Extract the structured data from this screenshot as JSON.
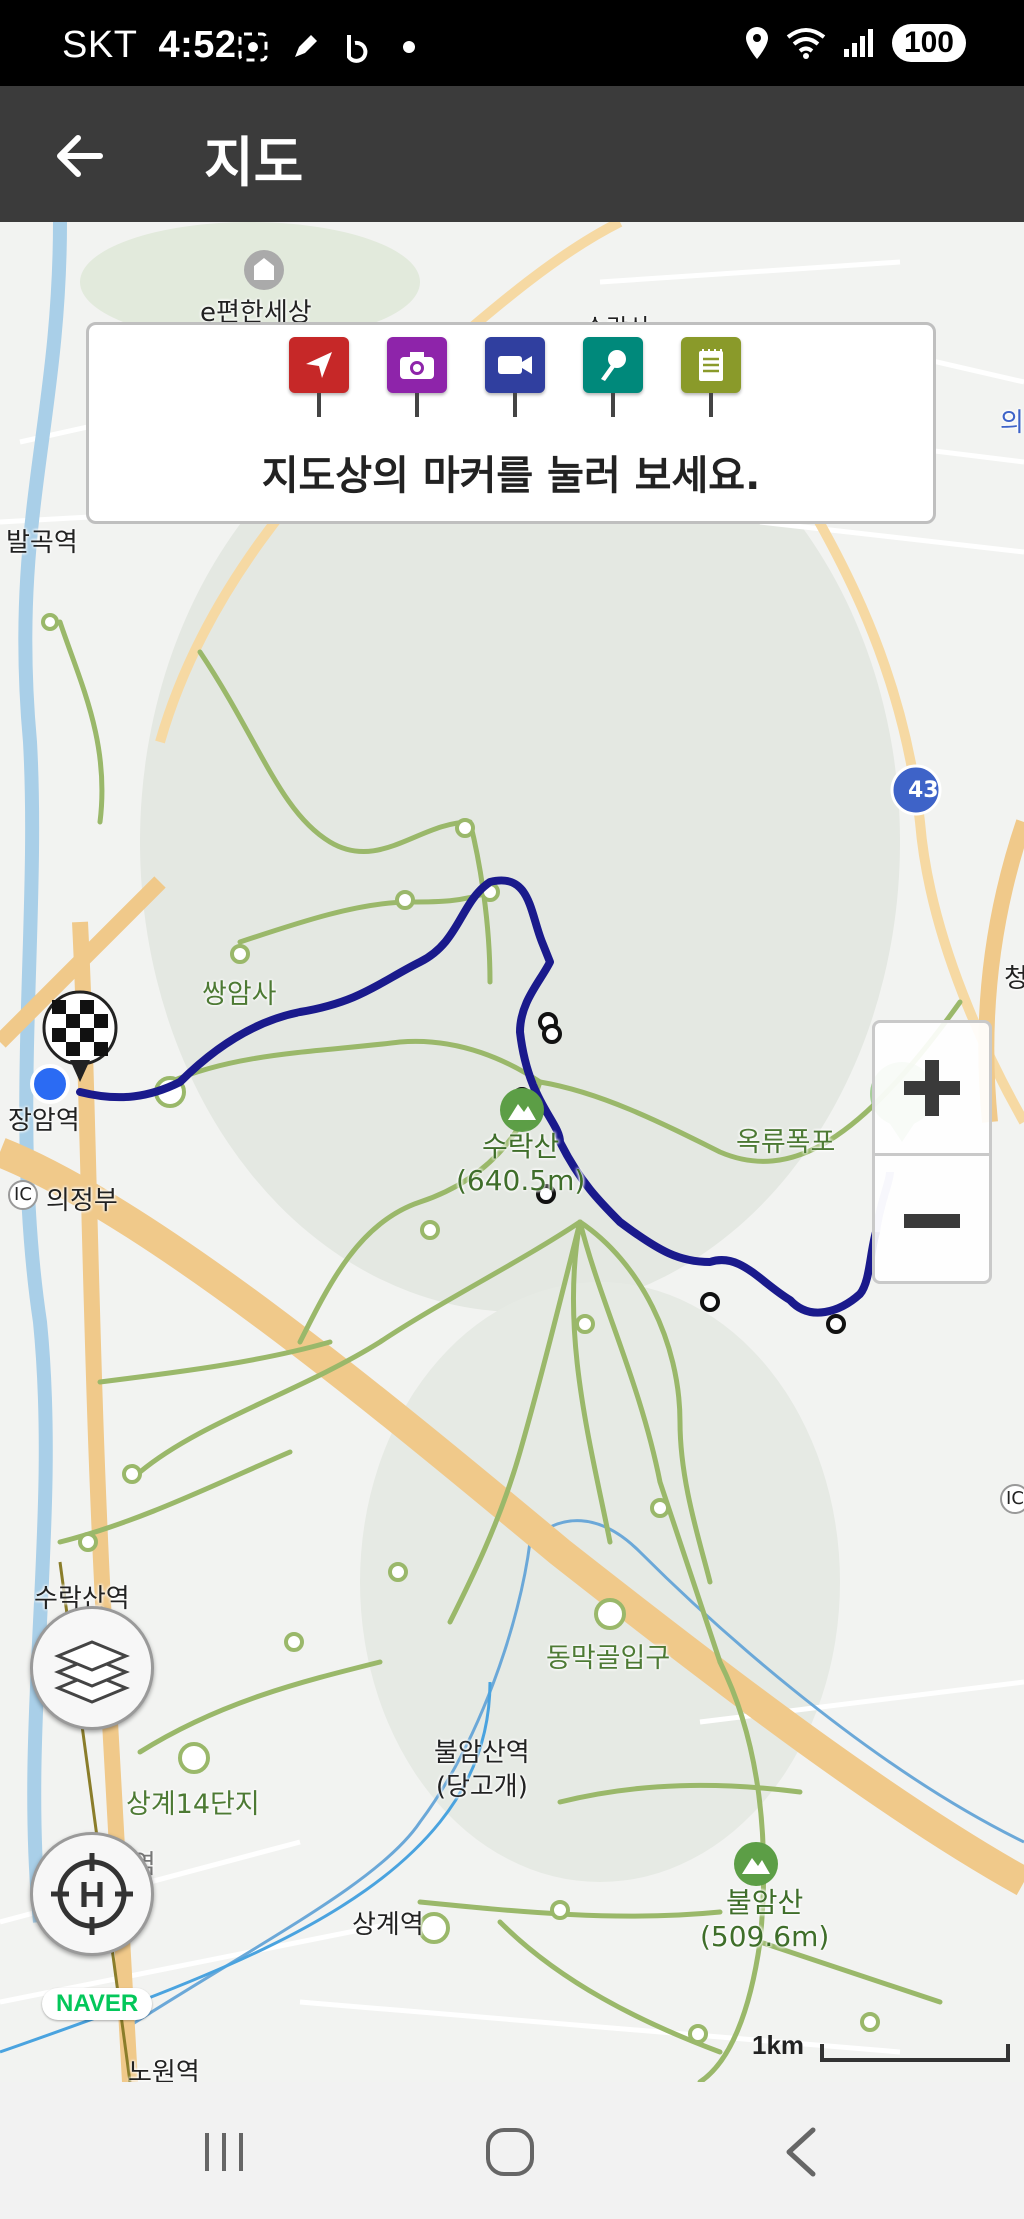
{
  "status_bar": {
    "carrier": "SKT",
    "time": "4:52",
    "battery": "100",
    "icons": [
      "screenshot-icon",
      "pen-icon",
      "b-app-icon",
      "dot-icon",
      "location-icon",
      "wifi-icon",
      "signal-icon"
    ]
  },
  "app_bar": {
    "title": "지도",
    "back_icon": "arrow-left-icon"
  },
  "legend": {
    "message": "지도상의 마커를 눌러 보세요.",
    "markers": [
      {
        "name": "direction-marker",
        "icon": "navigation-arrow-icon",
        "color": "#c62828"
      },
      {
        "name": "photo-marker",
        "icon": "camera-icon",
        "color": "#8e24aa"
      },
      {
        "name": "video-marker",
        "icon": "video-camera-icon",
        "color": "#303f9f"
      },
      {
        "name": "audio-marker",
        "icon": "microphone-icon",
        "color": "#00897b"
      },
      {
        "name": "memo-marker",
        "icon": "notepad-icon",
        "color": "#8a9a2a"
      }
    ]
  },
  "map": {
    "labels": {
      "e_mart": "e편한세상",
      "suraksan_top": "수락산",
      "balgok": "발곡역",
      "ssangamsa": "쌍암사",
      "jangam": "장암역",
      "uijeongbu": "의정부",
      "ic": "IC",
      "suraksan_peak_name": "수락산",
      "suraksan_peak_height": "(640.5m)",
      "okryu": "옥류폭포",
      "route_43": "43",
      "suraksan_station": "수락산역",
      "dongmakgol": "동막골입구",
      "buramsan_station": "불암산역",
      "danggogae": "(당고개)",
      "sanggye14": "상계14단지",
      "sanggye_station": "상계역",
      "buramsan_peak_name": "불암산",
      "buramsan_peak_height": "(509.6m)",
      "nowon": "노원역",
      "madeul": "마들역",
      "ch": "청",
      "edge_ic": "IC",
      "edge_right": "의"
    },
    "branding": "NAVER",
    "scale_label": "1km",
    "route_color": "#1a1a8c",
    "trail_color": "#9ab86a",
    "road_color": "#f0c98a"
  },
  "controls": {
    "zoom_in_icon": "plus-icon",
    "zoom_out_icon": "minus-icon",
    "layers_icon": "layers-icon",
    "home_icon": "home-crosshair-icon"
  },
  "nav_bar": {
    "recent_icon": "recent-apps-icon",
    "home_icon": "home-circle-icon",
    "back_icon": "back-chevron-icon"
  }
}
